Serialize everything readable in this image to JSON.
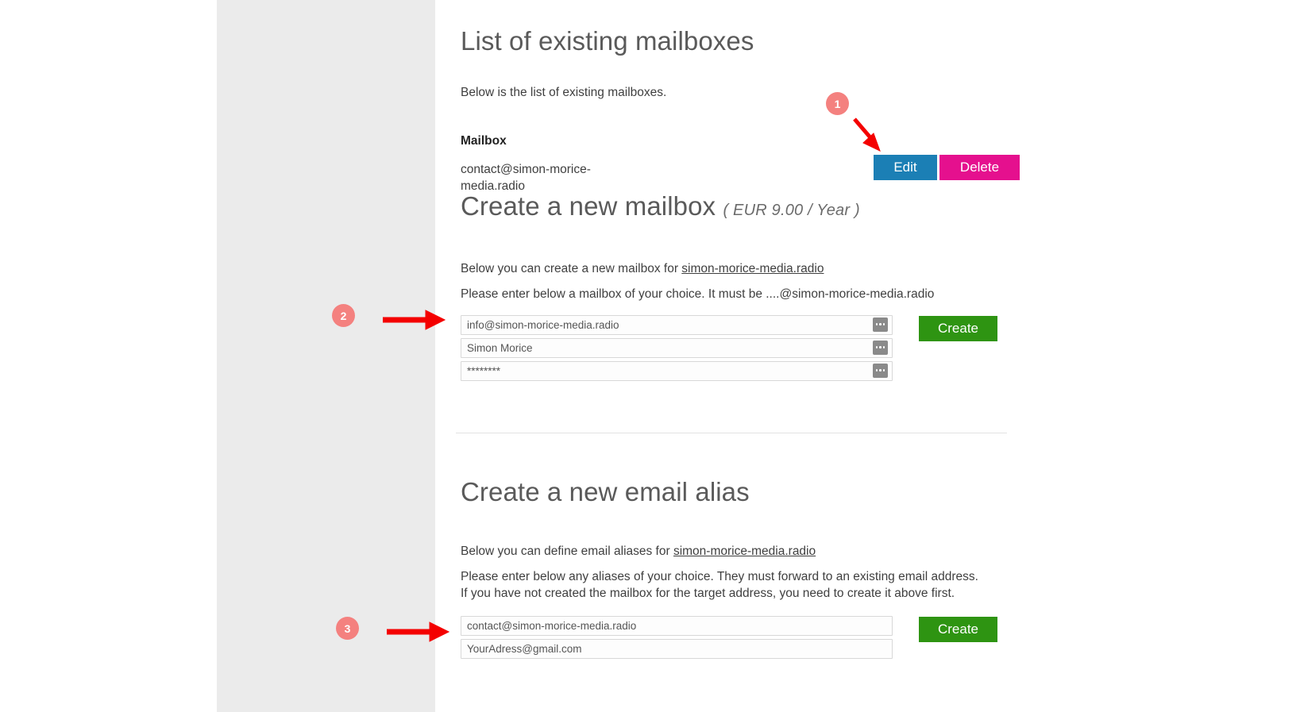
{
  "sections": {
    "mailbox_list": {
      "title": "List of existing mailboxes",
      "intro": "Below is the list of existing mailboxes.",
      "column_header": "Mailbox",
      "rows": [
        {
          "address": "contact@simon-morice-media.radio",
          "edit_label": "Edit",
          "delete_label": "Delete"
        }
      ]
    },
    "create_mailbox": {
      "title": "Create a new mailbox",
      "price_note": "( EUR 9.00 / Year )",
      "lead_prefix": "Below you can create a new mailbox for ",
      "domain": "simon-morice-media.radio",
      "instruction": "Please enter below a mailbox of your choice. It must be ....@simon-morice-media.radio",
      "fields": {
        "mailbox": {
          "value": "info@simon-morice-media.radio",
          "placeholder": "info@simon-morice-media.radio"
        },
        "display_name": {
          "value": "Simon Morice",
          "placeholder": "Simon Morice"
        },
        "password": {
          "value": "********",
          "placeholder": "********"
        }
      },
      "create_label": "Create"
    },
    "create_alias": {
      "title": "Create a new email alias",
      "lead_prefix": "Below you can define email aliases for ",
      "domain": "simon-morice-media.radio",
      "instruction_line1": "Please enter below any aliases of your choice. They must forward to an existing email address.",
      "instruction_line2": "If you have not created the mailbox for the target address, you need to create it above first.",
      "fields": {
        "alias": {
          "value": "contact@simon-morice-media.radio",
          "placeholder": "contact@simon-morice-media.radio"
        },
        "forward_to": {
          "value": "YourAdress@gmail.com",
          "placeholder": "YourAdress@gmail.com"
        }
      },
      "create_label": "Create"
    }
  },
  "annotations": {
    "badges": [
      {
        "label": "1"
      },
      {
        "label": "2"
      },
      {
        "label": "3"
      }
    ]
  },
  "colors": {
    "edit_button": "#1b7fb5",
    "delete_button": "#e5108e",
    "create_button": "#2e9412",
    "badge": "#f4817f",
    "arrow": "#f40000",
    "rail": "#ebebeb"
  }
}
